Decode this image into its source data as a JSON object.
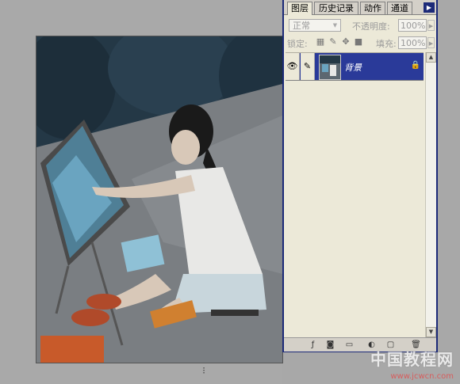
{
  "panel": {
    "tabs": [
      "图层",
      "历史记录",
      "动作",
      "通道"
    ],
    "menu_icon": "triangle-right-icon",
    "blend_mode": "正常",
    "opacity_label": "不透明度:",
    "opacity_value": "100%",
    "lock_label": "锁定:",
    "fill_label": "填充:",
    "fill_value": "100%",
    "layers": [
      {
        "name": "背景",
        "visible": true,
        "locked": true,
        "selected": true
      }
    ],
    "bottom_icons": [
      "link-icon",
      "add-style-icon",
      "add-mask-icon",
      "new-fill-layer-icon",
      "new-set-icon",
      "new-layer-icon",
      "trash-icon"
    ]
  },
  "canvas": {
    "resize_grip": "⁝"
  },
  "watermark": {
    "text": "中国教程网",
    "url": "www.jcwcn.com"
  },
  "colors": {
    "panel_border": "#1c2a78",
    "selected_layer": "#2a3a99",
    "panel_bg": "#ece9d8"
  }
}
